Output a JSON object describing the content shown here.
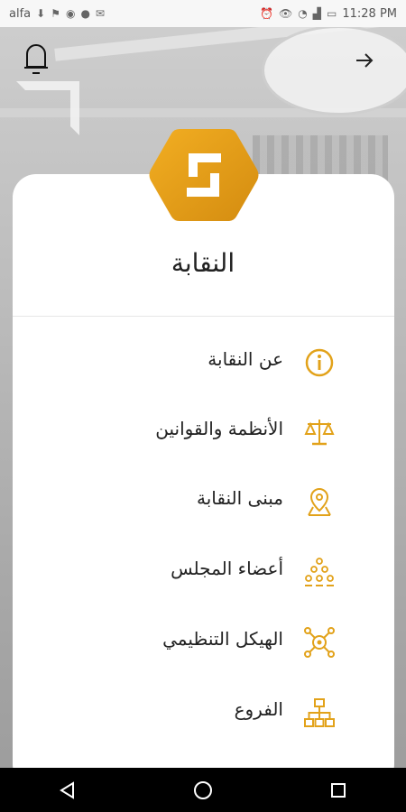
{
  "status_bar": {
    "carrier": "alfa",
    "time": "11:28 PM"
  },
  "header": {
    "notifications_icon": "bell-icon",
    "back_icon": "arrow-right-icon"
  },
  "brand": {
    "logo": "hexagon-logo",
    "accent_color": "#E2A21A"
  },
  "page": {
    "title": "النقابة"
  },
  "menu": {
    "items": [
      {
        "label": "عن النقابة",
        "icon": "info-icon"
      },
      {
        "label": "الأنظمة والقوانين",
        "icon": "scales-icon"
      },
      {
        "label": "مبنى النقابة",
        "icon": "location-pin-icon"
      },
      {
        "label": "أعضاء المجلس",
        "icon": "members-icon"
      },
      {
        "label": "الهيكل التنظيمي",
        "icon": "org-network-icon"
      },
      {
        "label": "الفروع",
        "icon": "branches-icon"
      }
    ]
  },
  "navigation_bar": {
    "back": "nav-back-icon",
    "home": "nav-home-icon",
    "recents": "nav-recents-icon"
  }
}
